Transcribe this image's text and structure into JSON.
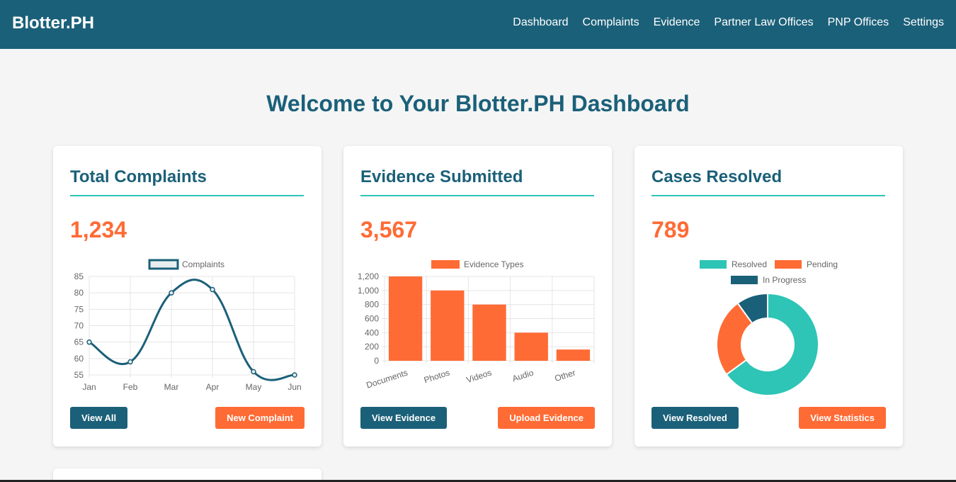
{
  "navbar": {
    "brand": "Blotter.PH",
    "links": [
      "Dashboard",
      "Complaints",
      "Evidence",
      "Partner Law Offices",
      "PNP Offices",
      "Settings"
    ]
  },
  "page_title": "Welcome to Your Blotter.PH Dashboard",
  "colors": {
    "primary": "#1b6079",
    "accent": "#ff6b35",
    "teal": "#2ec4b6"
  },
  "cards": [
    {
      "title": "Total Complaints",
      "value": "1,234",
      "buttons": [
        "View All",
        "New Complaint"
      ]
    },
    {
      "title": "Evidence Submitted",
      "value": "3,567",
      "buttons": [
        "View Evidence",
        "Upload Evidence"
      ]
    },
    {
      "title": "Cases Resolved",
      "value": "789",
      "buttons": [
        "View Resolved",
        "View Statistics"
      ]
    }
  ],
  "chart_data": [
    {
      "type": "line",
      "legend": [
        "Complaints"
      ],
      "series": [
        {
          "name": "Complaints",
          "values": [
            65,
            59,
            80,
            81,
            56,
            55
          ],
          "color": "#1b6079"
        }
      ],
      "categories": [
        "Jan",
        "Feb",
        "Mar",
        "Apr",
        "May",
        "Jun"
      ],
      "ylim": [
        55,
        85
      ],
      "yticks": [
        55,
        60,
        65,
        70,
        75,
        80,
        85
      ],
      "grid": true,
      "legend_position": "top"
    },
    {
      "type": "bar",
      "legend": [
        "Evidence Types"
      ],
      "series": [
        {
          "name": "Evidence Types",
          "values": [
            1200,
            1000,
            800,
            400,
            160
          ],
          "color": "#ff6b35"
        }
      ],
      "categories": [
        "Documents",
        "Photos",
        "Videos",
        "Audio",
        "Other"
      ],
      "ylim": [
        0,
        1200
      ],
      "yticks": [
        "0",
        "200",
        "400",
        "600",
        "800",
        "1,000",
        "1,200"
      ],
      "grid": true,
      "legend_position": "top"
    },
    {
      "type": "pie",
      "legend": [
        "Resolved",
        "Pending",
        "In Progress"
      ],
      "categories": [
        "Resolved",
        "Pending",
        "In Progress"
      ],
      "values": [
        65,
        25,
        10
      ],
      "colors": [
        "#2ec4b6",
        "#ff6b35",
        "#1b6079"
      ],
      "legend_position": "top"
    }
  ]
}
